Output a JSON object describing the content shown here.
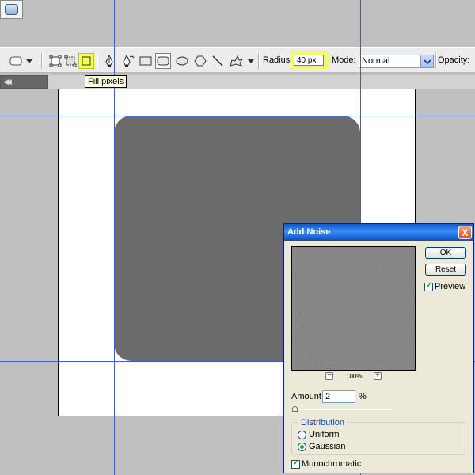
{
  "options_bar": {
    "radius_label": "Radius:",
    "radius_value": "40 px",
    "mode_label": "Mode:",
    "mode_value": "Normal",
    "opacity_label": "Opacity:"
  },
  "tooltip": {
    "text": "Fill pixels"
  },
  "colors": {
    "highlight": "#f2ff5a",
    "guide": "#3b5bdb",
    "shape_fill": "#6b6b6b",
    "title_bar": "#0a5ddb"
  },
  "dialog": {
    "title": "Add Noise",
    "close_glyph": "X",
    "ok_label": "OK",
    "reset_label": "Reset",
    "preview_label": "Preview",
    "preview_checked": true,
    "zoom_minus": "−",
    "zoom_level": "100%",
    "zoom_plus": "+",
    "amount_label": "Amount:",
    "amount_value": "2",
    "amount_unit": "%",
    "distribution_label": "Distribution",
    "uniform_label": "Uniform",
    "gaussian_label": "Gaussian",
    "selected_distribution": "Gaussian",
    "monochromatic_label": "Monochromatic",
    "monochromatic_checked": true
  },
  "icons": [
    "rounded-rect-preset-icon",
    "dropdown-arrow-icon",
    "shape-layers-icon",
    "paths-icon",
    "fill-pixels-icon",
    "pen-icon",
    "freeform-pen-icon",
    "rectangle-tool-icon",
    "rounded-rectangle-tool-icon",
    "ellipse-tool-icon",
    "polygon-tool-icon",
    "line-tool-icon",
    "custom-shape-icon",
    "chevron-down-icon",
    "close-icon"
  ]
}
